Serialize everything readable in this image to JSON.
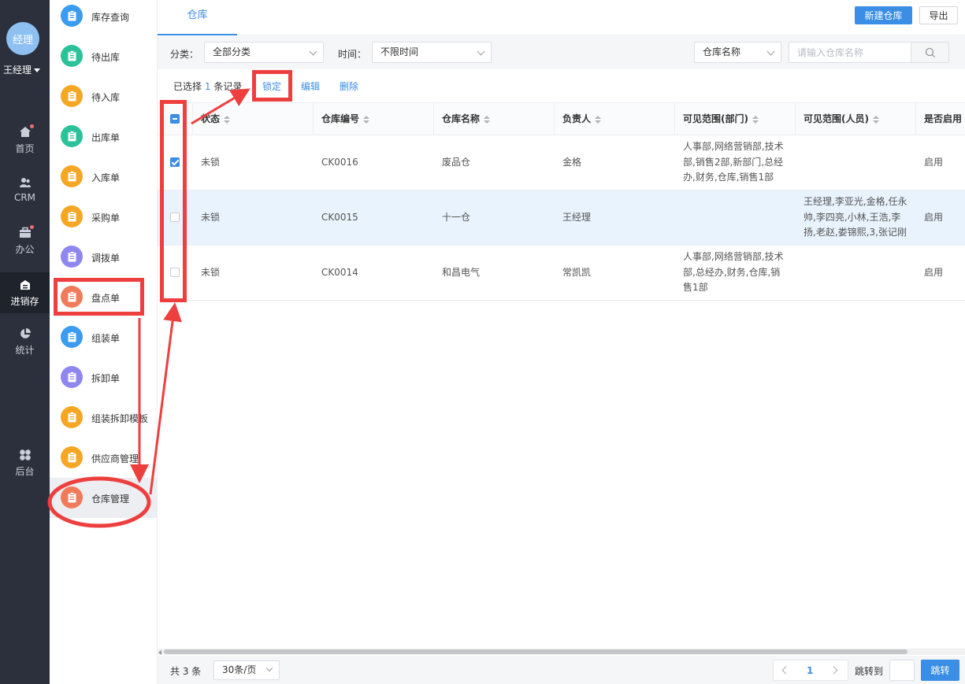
{
  "user": {
    "avatar_text": "经理",
    "name": "王经理"
  },
  "rail": [
    {
      "label": "首页",
      "icon": "home-icon",
      "dot": true
    },
    {
      "label": "CRM",
      "icon": "crm-icon",
      "dot": false
    },
    {
      "label": "办公",
      "icon": "briefcase-icon",
      "dot": true
    },
    {
      "label": "进销存",
      "icon": "inventory-icon",
      "dot": false,
      "active": true
    },
    {
      "label": "统计",
      "icon": "pie-chart-icon",
      "dot": false
    },
    {
      "label": "后台",
      "icon": "grid-icon",
      "dot": false
    }
  ],
  "menu": [
    {
      "label": "库存查询",
      "color": "#3a9bf0"
    },
    {
      "label": "待出库",
      "color": "#2bc29a"
    },
    {
      "label": "待入库",
      "color": "#f5a623"
    },
    {
      "label": "出库单",
      "color": "#2bc29a"
    },
    {
      "label": "入库单",
      "color": "#f5a623"
    },
    {
      "label": "采购单",
      "color": "#f5a623"
    },
    {
      "label": "调拨单",
      "color": "#8f86f0"
    },
    {
      "label": "盘点单",
      "color": "#f07b5a"
    },
    {
      "label": "组装单",
      "color": "#3a9bf0"
    },
    {
      "label": "拆卸单",
      "color": "#8f86f0"
    },
    {
      "label": "组装拆卸模板",
      "color": "#f5a623"
    },
    {
      "label": "供应商管理",
      "color": "#f5a623"
    },
    {
      "label": "仓库管理",
      "color": "#f07b5a",
      "active": true
    }
  ],
  "tab": {
    "label": "仓库"
  },
  "toolbar": {
    "new_label": "新建仓库",
    "export_label": "导出"
  },
  "filter": {
    "category_label": "分类：",
    "category_value": "全部分类",
    "time_label": "时间：",
    "time_value": "不限时间",
    "search_field": "仓库名称",
    "search_placeholder": "请输入仓库名称"
  },
  "actions": {
    "selected_prefix": "已选择",
    "selected_count": "1",
    "selected_suffix": "条记录",
    "lock": "锁定",
    "edit": "编辑",
    "delete": "删除"
  },
  "table": {
    "columns": [
      "状态",
      "仓库编号",
      "仓库名称",
      "负责人",
      "可见范围(部门)",
      "可见范围(人员)",
      "是否启用"
    ],
    "rows": [
      {
        "checked": true,
        "status": "未锁",
        "code": "CK0016",
        "name": "废品仓",
        "owner": "金格",
        "dept": "人事部,网络营销部,技术部,销售2部,新部门,总经办,财务,仓库,销售1部",
        "people": "",
        "enabled": "启用"
      },
      {
        "checked": false,
        "status": "未锁",
        "code": "CK0015",
        "name": "十一仓",
        "owner": "王经理",
        "dept": "",
        "people": "王经理,李亚光,金格,任永帅,李四亮,小林,王浩,李扬,老赵,娄锦熙,3,张记刚",
        "enabled": "启用"
      },
      {
        "checked": false,
        "status": "未锁",
        "code": "CK0014",
        "name": "和昌电气",
        "owner": "常凯凯",
        "dept": "人事部,网络营销部,技术部,总经办,财务,仓库,销售1部",
        "people": "",
        "enabled": "启用"
      }
    ]
  },
  "footer": {
    "total": "共 3 条",
    "page_size": "30条/页",
    "current_page": "1",
    "jump_label": "跳转到",
    "jump_button": "跳转"
  },
  "annotation_color": "#ee3f3f"
}
